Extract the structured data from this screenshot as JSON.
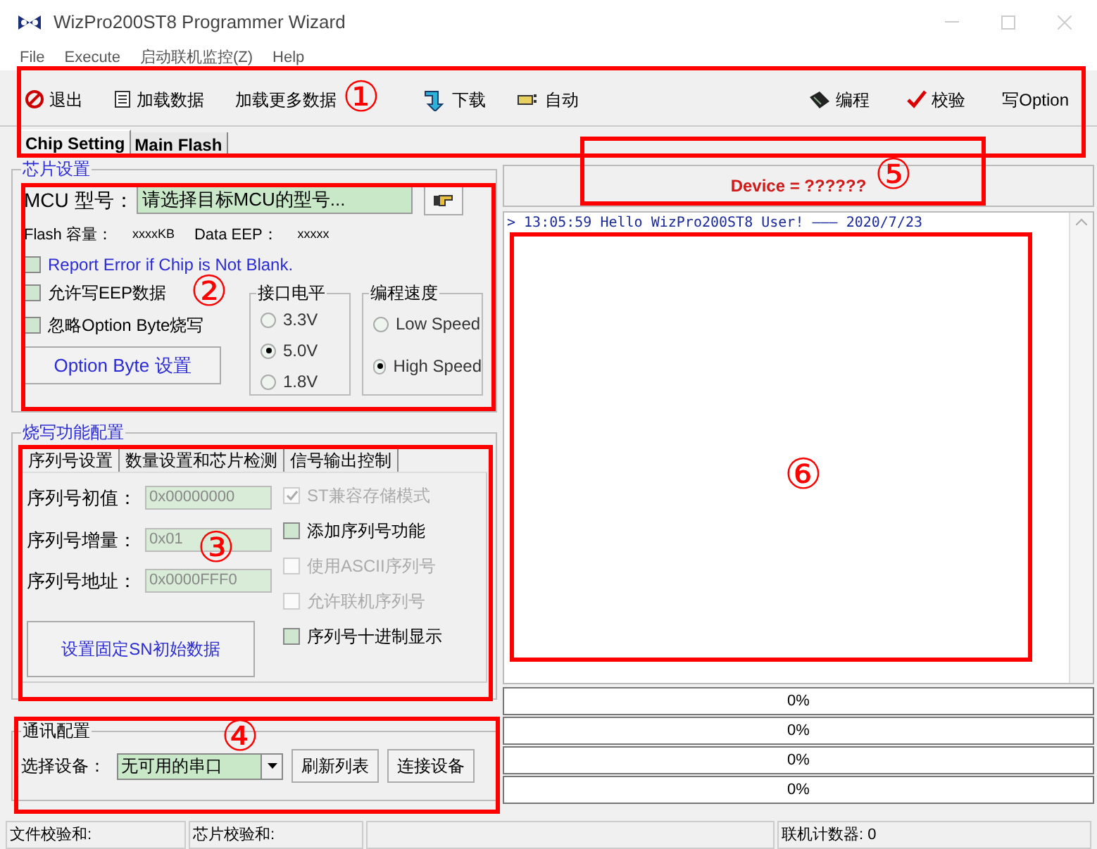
{
  "window": {
    "title": "WizPro200ST8 Programmer Wizard"
  },
  "menu": [
    "File",
    "Execute",
    "启动联机监控(Z)",
    "Help"
  ],
  "toolbar_left": [
    "退出",
    "加载数据",
    "加载更多数据",
    "下载",
    "自动"
  ],
  "toolbar_right": [
    "编程",
    "校验",
    "写Option"
  ],
  "tabs": [
    {
      "label": "Chip Setting",
      "selected": true
    },
    {
      "label": "Main Flash",
      "selected": false
    }
  ],
  "chip_settings": {
    "title": "芯片设置",
    "mcu_label": "MCU 型号：",
    "mcu_value": "请选择目标MCU的型号...",
    "flash_label": "Flash 容量：",
    "flash_value": "xxxxKB",
    "eep_label": "Data EEP：",
    "eep_value": "xxxxx",
    "checkboxes": [
      {
        "label": "Report Error if Chip is Not Blank.",
        "checked": false,
        "color": "#2b2bd6"
      },
      {
        "label": "允许写EEP数据",
        "checked": false,
        "color": "#000000"
      },
      {
        "label": "忽略Option Byte烧写",
        "checked": false,
        "color": "#000000"
      }
    ],
    "option_button": "Option Byte 设置",
    "voltage": {
      "title": "接口电平",
      "options": [
        {
          "label": "3.3V",
          "selected": false
        },
        {
          "label": "5.0V",
          "selected": true
        },
        {
          "label": "1.8V",
          "selected": false
        }
      ]
    },
    "speed": {
      "title": "编程速度",
      "options": [
        {
          "label": "Low Speed",
          "selected": false
        },
        {
          "label": "High Speed",
          "selected": true
        }
      ]
    }
  },
  "burn_config": {
    "title": "烧写功能配置",
    "tabs": [
      {
        "label": "序列号设置",
        "selected": true
      },
      {
        "label": "数量设置和芯片检测",
        "selected": false
      },
      {
        "label": "信号输出控制",
        "selected": false
      }
    ],
    "fields": [
      {
        "label": "序列号初值：",
        "value": "0x00000000"
      },
      {
        "label": "序列号增量：",
        "value": "0x01"
      },
      {
        "label": "序列号地址：",
        "value": "0x0000FFF0"
      }
    ],
    "checkboxes": [
      {
        "label": "ST兼容存储模式",
        "checked": true,
        "disabled": true
      },
      {
        "label": "添加序列号功能",
        "checked": false,
        "disabled": false
      },
      {
        "label": "使用ASCII序列号",
        "checked": false,
        "disabled": true
      },
      {
        "label": "允许联机序列号",
        "checked": false,
        "disabled": true
      },
      {
        "label": "序列号十进制显示",
        "checked": false,
        "disabled": false
      }
    ],
    "button": "设置固定SN初始数据"
  },
  "comm": {
    "title": "通讯配置",
    "device_label": "选择设备：",
    "device_value": "无可用的串口",
    "buttons": [
      "刷新列表",
      "连接设备"
    ]
  },
  "device_header": "Device = ??????",
  "log": [
    "> 13:05:59 Hello WizPro200ST8 User! ——— 2020/7/23"
  ],
  "progress": [
    {
      "reading": "0%",
      "level": 0
    },
    {
      "reading": "0%",
      "level": 0
    },
    {
      "reading": "0%",
      "level": 0
    },
    {
      "reading": "0%",
      "level": 0
    }
  ],
  "status_bar": {
    "file_checksum": "文件校验和:",
    "chip_checksum": "芯片校验和:",
    "counter": "联机计数器: 0"
  },
  "annotations": [
    {
      "label": "①"
    },
    {
      "label": "②"
    },
    {
      "label": "③"
    },
    {
      "label": "④"
    },
    {
      "label": "⑤"
    },
    {
      "label": "⑥"
    }
  ]
}
